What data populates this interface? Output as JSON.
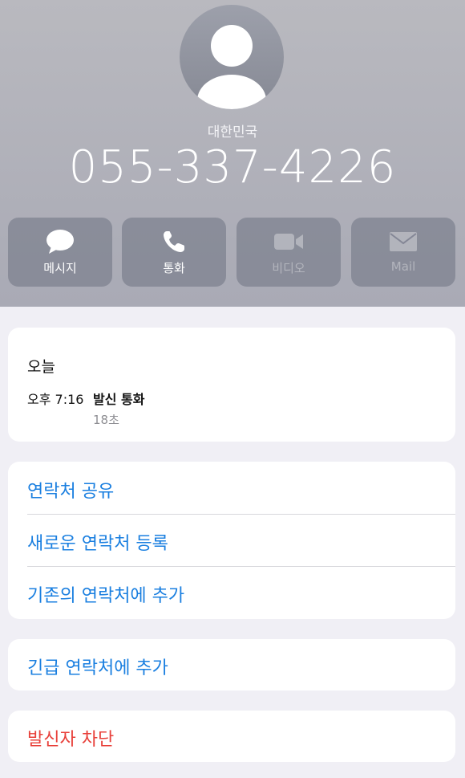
{
  "contact": {
    "country": "대한민국",
    "phone_number": "055-337-4226",
    "avatar_icon": "person-silhouette-icon"
  },
  "actions": [
    {
      "label": "메시지",
      "icon": "message-bubble-icon",
      "enabled": true
    },
    {
      "label": "통화",
      "icon": "phone-icon",
      "enabled": true
    },
    {
      "label": "비디오",
      "icon": "video-camera-icon",
      "enabled": false
    },
    {
      "label": "Mail",
      "icon": "mail-envelope-icon",
      "enabled": false
    }
  ],
  "recents": {
    "title": "오늘",
    "entries": [
      {
        "time": "오후 7:16",
        "type": "발신 통화",
        "duration": "18초"
      }
    ]
  },
  "options_group_1": [
    {
      "label": "연락처 공유"
    },
    {
      "label": "새로운 연락처 등록"
    },
    {
      "label": "기존의 연락처에 추가"
    }
  ],
  "options_group_2": [
    {
      "label": "긴급 연락처에 추가"
    }
  ],
  "options_group_3": [
    {
      "label": "발신자 차단"
    }
  ],
  "colors": {
    "link_blue": "#1a7fe0",
    "destructive_red": "#e8403a",
    "header_gray": "#b3b4bc"
  }
}
